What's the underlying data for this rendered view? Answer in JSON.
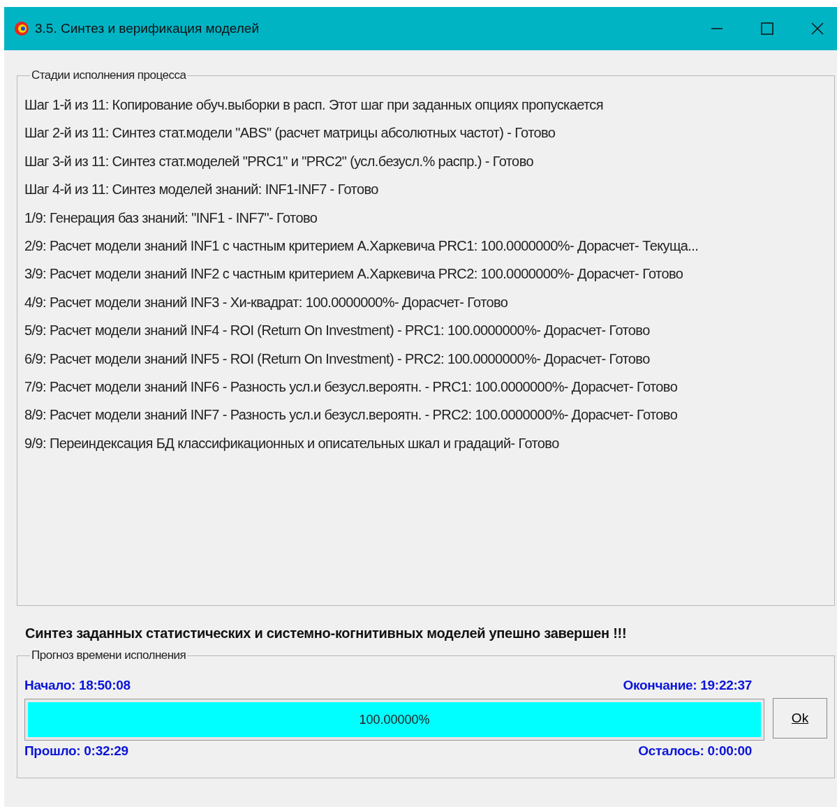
{
  "window": {
    "title": "3.5. Синтез и верификация моделей"
  },
  "stages": {
    "legend": "Стадии исполнения процесса",
    "lines": [
      "Шаг 1-й из 11: Копирование обуч.выборки в расп. Этот шаг при заданных опциях пропускается",
      "Шаг 2-й из 11: Синтез стат.модели \"ABS\" (расчет матрицы абсолютных частот) - Готово",
      "Шаг 3-й из 11: Синтез стат.моделей \"PRC1\" и \"PRC2\" (усл.безусл.% распр.) - Готово",
      "Шаг 4-й из 11: Синтез моделей знаний: INF1-INF7 - Готово",
      "1/9: Генерация баз знаний: \"INF1 - INF7\"- Готово",
      "2/9: Расчет модели знаний INF1 с частным критерием А.Харкевича PRC1: 100.0000000%- Дорасчет- Текуща...",
      "3/9: Расчет модели знаний INF2 с частным критерием А.Харкевича PRC2: 100.0000000%- Дорасчет- Готово",
      "4/9: Расчет модели знаний INF3 - Хи-квадрат: 100.0000000%- Дорасчет- Готово",
      "5/9: Расчет модели знаний INF4 - ROI (Return On Investment) - PRC1: 100.0000000%- Дорасчет- Готово",
      "6/9: Расчет модели знаний INF5 - ROI (Return On Investment) - PRC2: 100.0000000%- Дорасчет- Готово",
      "7/9: Расчет модели знаний INF6 - Разность усл.и безусл.вероятн. - PRC1: 100.0000000%- Дорасчет- Готово",
      "8/9: Расчет модели знаний INF7 - Разность усл.и безусл.вероятн. - PRC2: 100.0000000%- Дорасчет- Готово",
      "9/9: Переиндексация БД классификационных и описательных шкал и градаций- Готово"
    ]
  },
  "result_message": "Синтез заданных статистических и системно-когнитивных моделей упешно завершен !!!",
  "forecast": {
    "legend": "Прогноз времени исполнения",
    "start": "Начало: 18:50:08",
    "end": "Окончание: 19:22:37",
    "progress": {
      "level": 1.0,
      "label": "100.00000%"
    },
    "elapsed": "Прошло: 0:32:29",
    "remaining": "Осталось: 0:00:00",
    "ok_button": "Ok"
  }
}
